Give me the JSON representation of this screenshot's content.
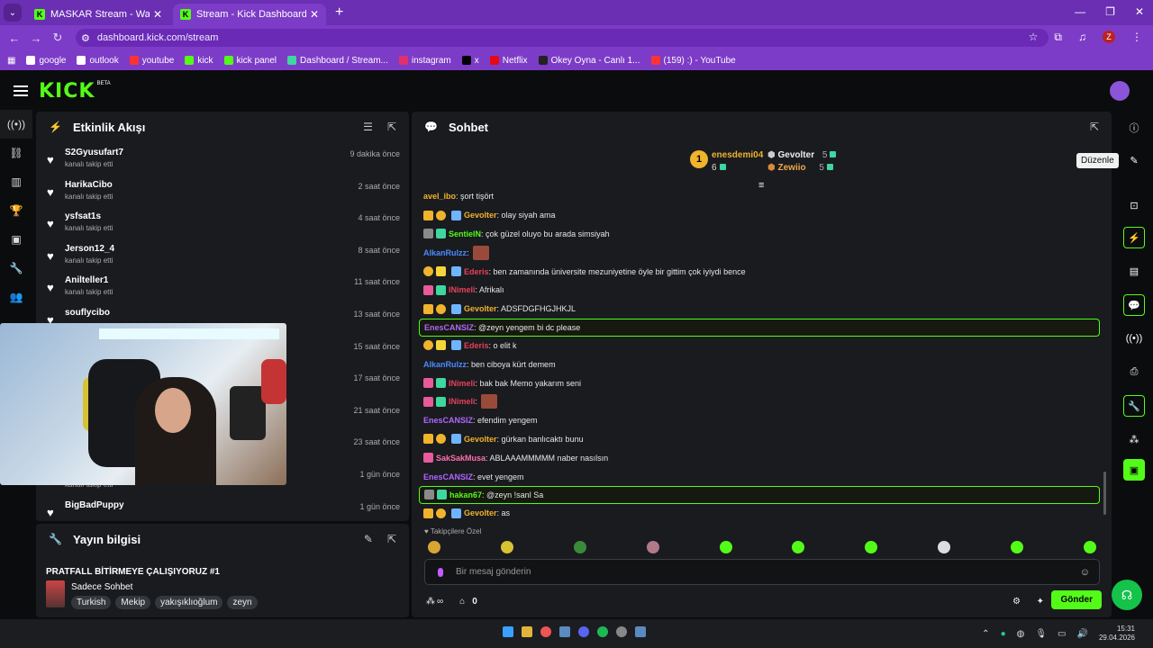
{
  "browser": {
    "tabs": [
      {
        "title": "MASKAR Stream - Watch Live o"
      },
      {
        "title": "Stream - Kick Dashboard"
      }
    ],
    "url": "dashboard.kick.com/stream",
    "profile_letter": "Z",
    "bookmarks": [
      "google",
      "outlook",
      "youtube",
      "kick",
      "kick panel",
      "Dashboard / Stream...",
      "instagram",
      "x",
      "Netflix",
      "Okey Oyna - Canlı 1...",
      "(159) :) - YouTube"
    ]
  },
  "kick": {
    "logo": "KICK",
    "beta": "BETA"
  },
  "activity": {
    "title": "Etkinlik Akışı",
    "items": [
      {
        "name": "S2Gyusufart7",
        "sub": "kanalı takip etti",
        "time": "9 dakika önce"
      },
      {
        "name": "HarikaCibo",
        "sub": "kanalı takip etti",
        "time": "2 saat önce"
      },
      {
        "name": "ysfsat1s",
        "sub": "kanalı takip etti",
        "time": "4 saat önce"
      },
      {
        "name": "Jerson12_4",
        "sub": "kanalı takip etti",
        "time": "8 saat önce"
      },
      {
        "name": "Anilteller1",
        "sub": "kanalı takip etti",
        "time": "11 saat önce"
      },
      {
        "name": "souflycibo",
        "sub": "",
        "time": "13 saat önce"
      },
      {
        "name": "",
        "sub": "",
        "time": "15 saat önce"
      },
      {
        "name": "",
        "sub": "",
        "time": "17 saat önce"
      },
      {
        "name": "",
        "sub": "",
        "time": "21 saat önce"
      },
      {
        "name": "",
        "sub": "",
        "time": "23 saat önce"
      },
      {
        "name": "",
        "sub": "kanalı takip etti",
        "time": "1 gün önce"
      },
      {
        "name": "BigBadPuppy",
        "sub": "",
        "time": "1 gün önce"
      }
    ]
  },
  "stream_info": {
    "title": "Yayın bilgisi",
    "stream_title": "PRATFALL BİTİRMEYE ÇALIŞIYORUZ #1",
    "category": "Sadece Sohbet",
    "tags": [
      "Turkish",
      "Mekip",
      "yakışıklıoğlum",
      "zeyn"
    ]
  },
  "chat": {
    "title": "Sohbet",
    "top_gifters": {
      "first": {
        "rank": "1",
        "name": "enesdemi04",
        "count": "6"
      },
      "second": {
        "name": "Gevolter",
        "count": "5"
      },
      "third": {
        "name": "Zewiio",
        "count": "5"
      }
    },
    "messages": [
      {
        "user": "avel_ibo",
        "color": "#f0b32c",
        "text": ": şort tişört",
        "badges": [],
        "hl": false,
        "emote": false
      },
      {
        "user": "Gevolter",
        "color": "#f0b32c",
        "text": ": olay siyah ama",
        "badges": [
          "crown",
          "one",
          "gift"
        ],
        "hl": false,
        "emote": false
      },
      {
        "user": "SentielN",
        "color": "#53fc18",
        "text": ": çok güzel oluyo bu arada simsiyah",
        "badges": [
          "cat",
          "grn"
        ],
        "hl": false,
        "emote": false
      },
      {
        "user": "AlkanRulzz",
        "color": "#4a8cff",
        "text": ": ",
        "badges": [],
        "hl": false,
        "emote": true
      },
      {
        "user": "Ederis",
        "color": "#e8405a",
        "text": ": ben zamanında üniversite mezuniyetine öyle bir gittim çok iyiydi bence",
        "badges": [
          "one",
          "yel",
          "gift"
        ],
        "hl": false,
        "emote": false
      },
      {
        "user": "INimeli",
        "color": "#e8405a",
        "text": ": Afrikalı",
        "badges": [
          "pink",
          "grn"
        ],
        "hl": false,
        "emote": false
      },
      {
        "user": "Gevolter",
        "color": "#f0b32c",
        "text": ": ADSFDGFHGJHKJL",
        "badges": [
          "crown",
          "one",
          "gift"
        ],
        "hl": false,
        "emote": false
      },
      {
        "user": "EnesCANSIZ",
        "color": "#b266ff",
        "text": ": @zeyn yengem bi dc please",
        "badges": [],
        "hl": true,
        "emote": false
      },
      {
        "user": "Ederis",
        "color": "#e8405a",
        "text": ": o elit k",
        "badges": [
          "one",
          "yel",
          "gift"
        ],
        "hl": false,
        "emote": false
      },
      {
        "user": "AlkanRulzz",
        "color": "#4a8cff",
        "text": ": ben ciboya kürt demem",
        "badges": [],
        "hl": false,
        "emote": false
      },
      {
        "user": "INimeli",
        "color": "#e8405a",
        "text": ": bak bak Memo yakarım seni",
        "badges": [
          "pink",
          "grn"
        ],
        "hl": false,
        "emote": false
      },
      {
        "user": "INimeli",
        "color": "#e8405a",
        "text": ": ",
        "badges": [
          "pink",
          "grn"
        ],
        "hl": false,
        "emote": true
      },
      {
        "user": "EnesCANSIZ",
        "color": "#b266ff",
        "text": ": efendim yengem",
        "badges": [],
        "hl": false,
        "emote": false
      },
      {
        "user": "Gevolter",
        "color": "#f0b32c",
        "text": ": gürkan banlıcaktı bunu",
        "badges": [
          "crown",
          "one",
          "gift"
        ],
        "hl": false,
        "emote": false
      },
      {
        "user": "SakSakMusa",
        "color": "#ff6fae",
        "text": ": ABLAAAMMMMM naber nasılsın",
        "badges": [
          "pink"
        ],
        "hl": false,
        "emote": false
      },
      {
        "user": "EnesCANSIZ",
        "color": "#b266ff",
        "text": ": evet yengem",
        "badges": [],
        "hl": false,
        "emote": false
      },
      {
        "user": "hakan67",
        "color": "#53fc18",
        "text": ": @zeyn !sanl Sa",
        "badges": [
          "cat",
          "grn"
        ],
        "hl": true,
        "emote": false
      },
      {
        "user": "Gevolter",
        "color": "#f0b32c",
        "text": ": as",
        "badges": [
          "crown",
          "one",
          "gift"
        ],
        "hl": false,
        "emote": false
      }
    ],
    "followers_only_label": "Takipçilere Özel",
    "input_placeholder": "Bir mesaj gönderin",
    "infinity": "∞",
    "points": "0",
    "send_label": "Gönder"
  },
  "right_rail": {
    "tooltip": "Düzenle"
  },
  "taskbar": {
    "time": "15:31",
    "date": "29.04.2026"
  }
}
